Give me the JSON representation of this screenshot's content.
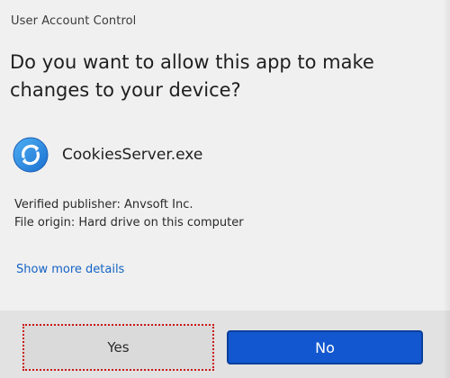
{
  "window": {
    "title": "User Account Control"
  },
  "prompt": {
    "question": "Do you want to allow this app to make changes to your device?"
  },
  "app": {
    "name": "CookiesServer.exe",
    "icon": "blue-circular-arrows-icon"
  },
  "info": {
    "publisher": "Verified publisher: Anvsoft Inc.",
    "origin": "File origin: Hard drive on this computer"
  },
  "links": {
    "show_details": "Show more details"
  },
  "buttons": {
    "yes_label": "Yes",
    "no_label": "No"
  },
  "colors": {
    "accent": "#1257cf",
    "link": "#1463c4",
    "highlight_border": "#cc1616",
    "background": "#f0f0f0"
  }
}
